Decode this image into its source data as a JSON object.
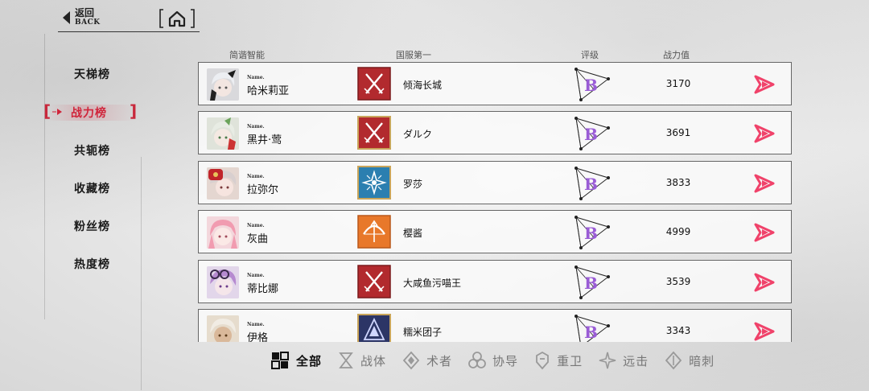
{
  "header": {
    "back_cn": "返回",
    "back_en": "BACK",
    "home_icon": "home-icon"
  },
  "nav": {
    "items": [
      {
        "label": "天梯榜",
        "active": false
      },
      {
        "label": "战力榜",
        "active": true
      },
      {
        "label": "共轭榜",
        "active": false
      },
      {
        "label": "收藏榜",
        "active": false
      },
      {
        "label": "粉丝榜",
        "active": false
      },
      {
        "label": "热度榜",
        "active": false
      }
    ]
  },
  "columns": {
    "character": "简谐智能",
    "top_player": "国服第一",
    "rating": "评级",
    "power": "战力值"
  },
  "rows": [
    {
      "name_label": "Name.",
      "name": "哈米莉亚",
      "class": "crossed-swords-icon",
      "top_player": "倾海长城",
      "rating": "B",
      "power": "3170"
    },
    {
      "name_label": "Name.",
      "name": "黑井·莺",
      "class": "crossed-swords-icon",
      "top_player": "ダルク",
      "rating": "B",
      "power": "3691"
    },
    {
      "name_label": "Name.",
      "name": "拉弥尔",
      "class": "star-burst-icon",
      "top_player": "罗莎",
      "rating": "B",
      "power": "3833"
    },
    {
      "name_label": "Name.",
      "name": "灰曲",
      "class": "bow-icon",
      "top_player": "樱酱",
      "rating": "B",
      "power": "4999"
    },
    {
      "name_label": "Name.",
      "name": "蒂比娜",
      "class": "crossed-swords-icon",
      "top_player": "大咸鱼污喵王",
      "rating": "B",
      "power": "3539"
    },
    {
      "name_label": "Name.",
      "name": "伊格",
      "class": "shield-icon",
      "top_player": "糯米团子",
      "rating": "B",
      "power": "3343"
    }
  ],
  "filters": [
    {
      "label": "全部",
      "icon": "grid-icon",
      "active": true
    },
    {
      "label": "战体",
      "icon": "hourglass-icon",
      "active": false
    },
    {
      "label": "术者",
      "icon": "diamond-icon",
      "active": false
    },
    {
      "label": "协导",
      "icon": "trefoil-icon",
      "active": false
    },
    {
      "label": "重卫",
      "icon": "helmet-icon",
      "active": false
    },
    {
      "label": "远击",
      "icon": "star-target-icon",
      "active": false
    },
    {
      "label": "暗刺",
      "icon": "diamond-blade-icon",
      "active": false
    }
  ],
  "colors": {
    "accent_red": "#d0243a",
    "sword_red": "#b22a2e",
    "blue_class": "#2b7fb0",
    "orange_class": "#e8782a",
    "navy_class": "#2c3566",
    "rating_purple": "#9a5cd6",
    "arrow_pink": "#f0426a"
  }
}
